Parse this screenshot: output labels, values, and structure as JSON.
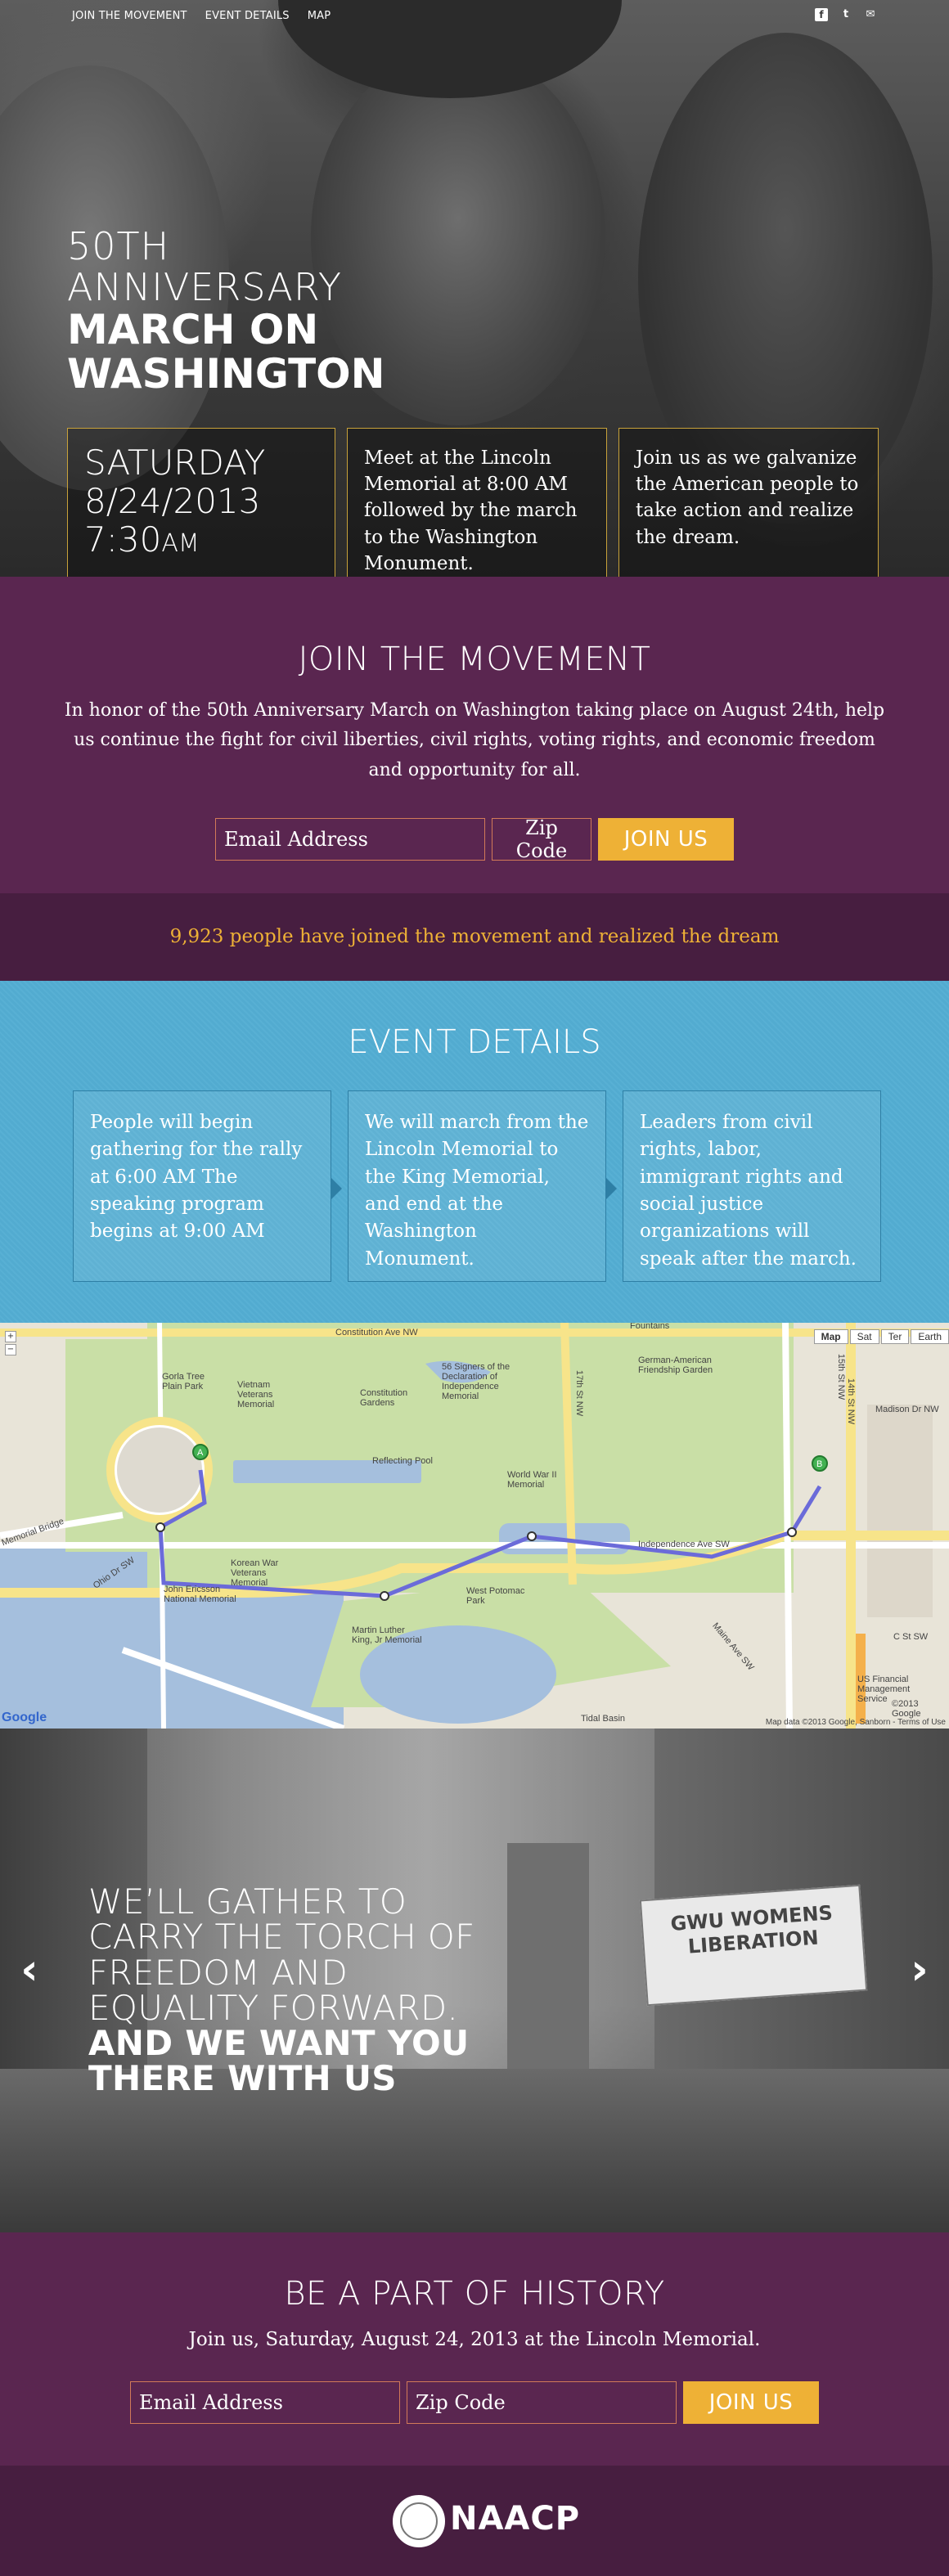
{
  "nav": {
    "links": [
      "JOIN THE MOVEMENT",
      "EVENT DETAILS",
      "MAP"
    ]
  },
  "social": {
    "facebook": "f",
    "twitter": "t",
    "email": "✉"
  },
  "hero": {
    "title_line1": "50TH",
    "title_line2": "ANNIVERSARY",
    "title_line3": "MARCH ON",
    "title_line4": "WASHINGTON",
    "date_day": "SATURDAY",
    "date_date": "8/24/2013",
    "date_time": "7:30",
    "date_ampm": "AM",
    "box2": "Meet at the Lincoln Memorial at 8:00 AM followed by the march to the Washington Monument.",
    "box3": "Join us as we galvanize the American people to take action and realize the dream."
  },
  "join": {
    "heading": "JOIN THE MOVEMENT",
    "body": "In honor of the 50th Anniversary March on Washington taking place on August 24th, help us continue the fight for civil liberties, civil rights, voting rights, and economic freedom and opportunity for all.",
    "email_placeholder": "Email Address",
    "zip_placeholder": "Zip Code",
    "button": "JOIN US"
  },
  "counter": {
    "count": "9,923",
    "text": "people have joined the movement and realized the dream"
  },
  "events": {
    "heading": "EVENT DETAILS",
    "cards": [
      "People will begin gathering for the rally at 6:00 AM The speaking program begins at 9:00 AM",
      "We will march from the Lincoln Memorial to the King Memorial, and end at the Washington Monument.",
      "Leaders from civil rights, labor, immigrant rights and social justice organizations will speak after the march."
    ]
  },
  "map": {
    "types": [
      "Map",
      "Sat",
      "Ter",
      "Earth"
    ],
    "labels": {
      "constitution": "Constitution Ave NW",
      "independence": "Independence Ave SW",
      "reflecting": "Reflecting Pool",
      "vietnam": "Vietnam Veterans Memorial",
      "constitution_gardens": "Constitution Gardens",
      "wwii": "World War II Memorial",
      "korean": "Korean War Veterans Memorial",
      "mlk": "Martin Luther King, Jr Memorial",
      "west_potomac": "West Potomac Park",
      "ohio": "Ohio Dr SW",
      "memorial_bridge": "Memorial Bridge",
      "madison": "Madison Dr NW",
      "c_st": "C St SW",
      "signers": "56 Signers of the Declaration of Independence Memorial",
      "german": "German-American Friendship Garden",
      "fountains": "Fountains",
      "ericsson": "John Ericsson National Memorial",
      "gorla": "Gorla Tree Plain Park",
      "17th": "17th St NW",
      "14th": "14th St NW",
      "15th": "15th St NW",
      "maine": "Maine Ave SW",
      "tidal": "Tidal Basin",
      "usfin": "US Financial Management Service",
      "marker_a": "A",
      "marker_b": "B"
    },
    "credit": "Map data ©2013 Google, Sanborn - Terms of Use",
    "google": "Google",
    "copyright": "©2013 Google"
  },
  "quote": {
    "line1": "WE’LL GATHER TO",
    "line2": "CARRY THE TORCH OF",
    "line3": "FREEDOM AND",
    "line4": "EQUALITY FORWARD.",
    "line5": "AND WE WANT YOU",
    "line6": "THERE WITH US",
    "banner": "GWU WOMENS LIBERATION",
    "prev": "‹",
    "next": "›"
  },
  "history": {
    "heading": "BE A PART OF HISTORY",
    "body": "Join us, Saturday, August 24, 2013 at the Lincoln Memorial.",
    "email_placeholder": "Email Address",
    "zip_placeholder": "Zip Code",
    "button": "JOIN US"
  },
  "footer": {
    "logo": "NAACP"
  }
}
